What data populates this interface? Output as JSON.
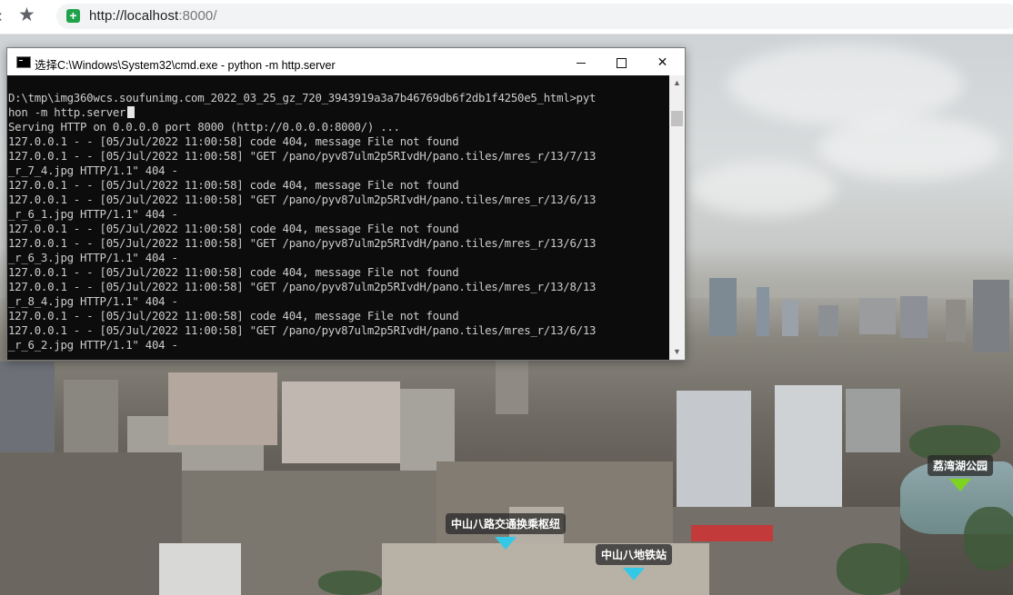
{
  "browser": {
    "url_host": "http://localhost",
    "url_port": ":8000/",
    "star_icon": "★"
  },
  "cmd": {
    "title": "选择C:\\Windows\\System32\\cmd.exe - python  -m http.server",
    "lines": [
      "D:\\tmp\\img360wcs.soufunimg.com_2022_03_25_gz_720_3943919a3a7b46769db6f2db1f4250e5_html>pyt",
      "hon -m http.server",
      "Serving HTTP on 0.0.0.0 port 8000 (http://0.0.0.0:8000/) ...",
      "127.0.0.1 - - [05/Jul/2022 11:00:58] code 404, message File not found",
      "127.0.0.1 - - [05/Jul/2022 11:00:58] \"GET /pano/pyv87ulm2p5RIvdH/pano.tiles/mres_r/13/7/13",
      "_r_7_4.jpg HTTP/1.1\" 404 -",
      "127.0.0.1 - - [05/Jul/2022 11:00:58] code 404, message File not found",
      "127.0.0.1 - - [05/Jul/2022 11:00:58] \"GET /pano/pyv87ulm2p5RIvdH/pano.tiles/mres_r/13/6/13",
      "_r_6_1.jpg HTTP/1.1\" 404 -",
      "127.0.0.1 - - [05/Jul/2022 11:00:58] code 404, message File not found",
      "127.0.0.1 - - [05/Jul/2022 11:00:58] \"GET /pano/pyv87ulm2p5RIvdH/pano.tiles/mres_r/13/6/13",
      "_r_6_3.jpg HTTP/1.1\" 404 -",
      "127.0.0.1 - - [05/Jul/2022 11:00:58] code 404, message File not found",
      "127.0.0.1 - - [05/Jul/2022 11:00:58] \"GET /pano/pyv87ulm2p5RIvdH/pano.tiles/mres_r/13/8/13",
      "_r_8_4.jpg HTTP/1.1\" 404 -",
      "127.0.0.1 - - [05/Jul/2022 11:00:58] code 404, message File not found",
      "127.0.0.1 - - [05/Jul/2022 11:00:58] \"GET /pano/pyv87ulm2p5RIvdH/pano.tiles/mres_r/13/6/13",
      "_r_6_2.jpg HTTP/1.1\" 404 -"
    ]
  },
  "hotspots": {
    "zhongshan_transit": "中山八路交通换乘枢纽",
    "zhongshan_metro": "中山八地铁站",
    "liwan_lake_park": "荔湾湖公园"
  },
  "colors": {
    "hotspot_cyan": "#33c8e6",
    "hotspot_green": "#7ed321",
    "console_bg": "#0c0c0c",
    "console_text": "#cccccc"
  }
}
